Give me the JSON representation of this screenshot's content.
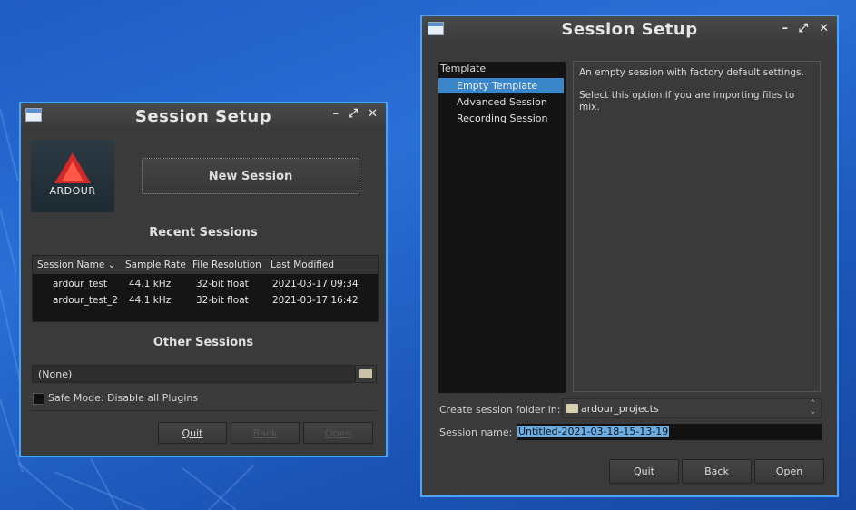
{
  "left_window": {
    "title": "Session Setup",
    "logo_text": "ARDOUR",
    "new_session_label": "New Session",
    "recent_heading": "Recent Sessions",
    "columns": [
      "Session Name",
      "Sample Rate",
      "File Resolution",
      "Last Modified"
    ],
    "rows": [
      {
        "name": "ardour_test",
        "rate": "44.1 kHz",
        "res": "32-bit float",
        "modified": "2021-03-17 09:34"
      },
      {
        "name": "ardour_test_2",
        "rate": "44.1 kHz",
        "res": "32-bit float",
        "modified": "2021-03-17 16:42"
      }
    ],
    "other_heading": "Other Sessions",
    "other_value": "(None)",
    "safe_mode_label": "Safe Mode: Disable all Plugins",
    "quit_label": "Quit",
    "back_label": "Back",
    "open_label": "Open"
  },
  "right_window": {
    "title": "Session Setup",
    "template_header": "Template",
    "templates": [
      "Empty Template",
      "Advanced Session",
      "Recording Session"
    ],
    "description_line1": "An empty session with factory default settings.",
    "description_line2": "Select this option if you are importing files to mix.",
    "folder_label": "Create session folder in:",
    "folder_value": "ardour_projects",
    "name_label": "Session name:",
    "name_value": "Untitled-2021-03-18-15-13-19",
    "quit_label": "Quit",
    "back_label": "Back",
    "open_label": "Open"
  },
  "colors": {
    "selection": "#3a86c8",
    "window_bg": "#3a3a3a",
    "accent_border": "#4aa3ff"
  }
}
